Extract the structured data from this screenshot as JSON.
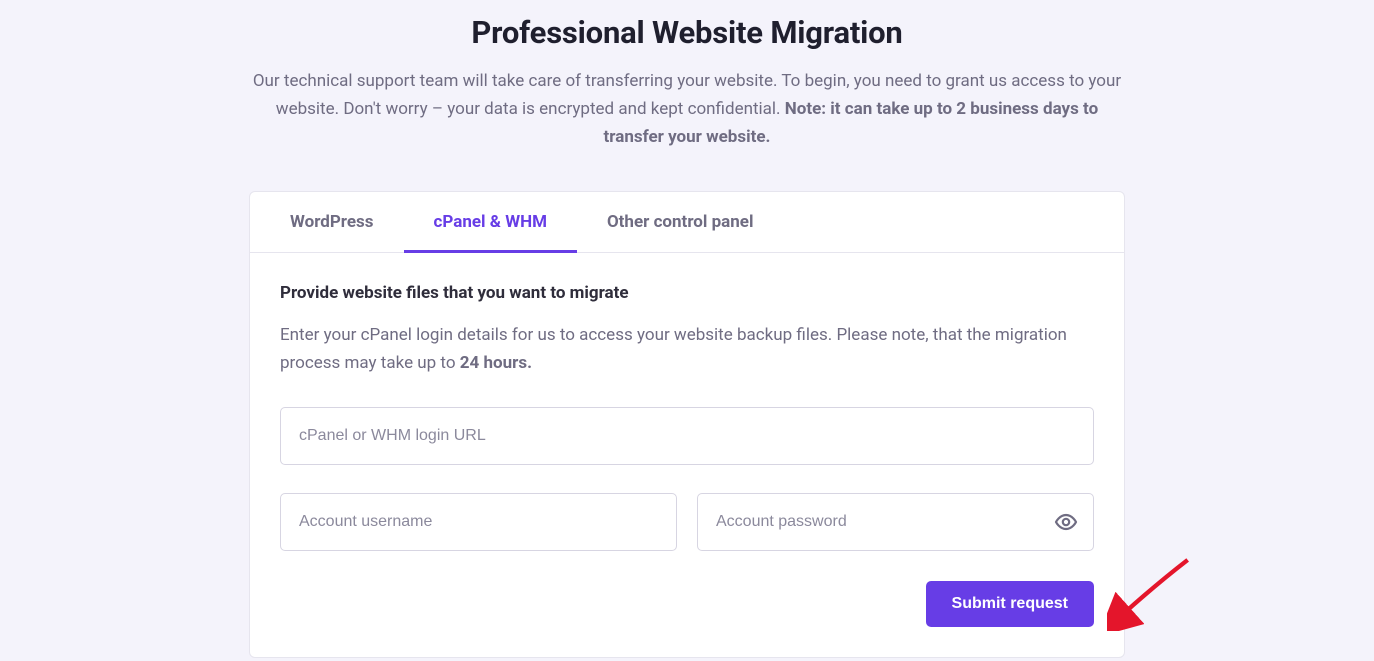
{
  "page": {
    "title": "Professional Website Migration",
    "subtitle_text": "Our technical support team will take care of transferring your website. To begin, you need to grant us access to your website. Don't worry – your data is encrypted and kept confidential. ",
    "subtitle_note": "Note: it can take up to 2 business days to transfer your website."
  },
  "tabs": {
    "wordpress": "WordPress",
    "cpanel": "cPanel & WHM",
    "other": "Other control panel",
    "active_index": 1
  },
  "panel": {
    "section_title": "Provide website files that you want to migrate",
    "desc_prefix": "Enter your cPanel login details for us to access your website backup files. Please note, that the migration process may take up to ",
    "desc_bold": "24 hours."
  },
  "form": {
    "login_url": {
      "placeholder": "cPanel or WHM login URL",
      "value": ""
    },
    "username": {
      "placeholder": "Account username",
      "value": ""
    },
    "password": {
      "placeholder": "Account password",
      "value": ""
    },
    "submit_label": "Submit request"
  }
}
